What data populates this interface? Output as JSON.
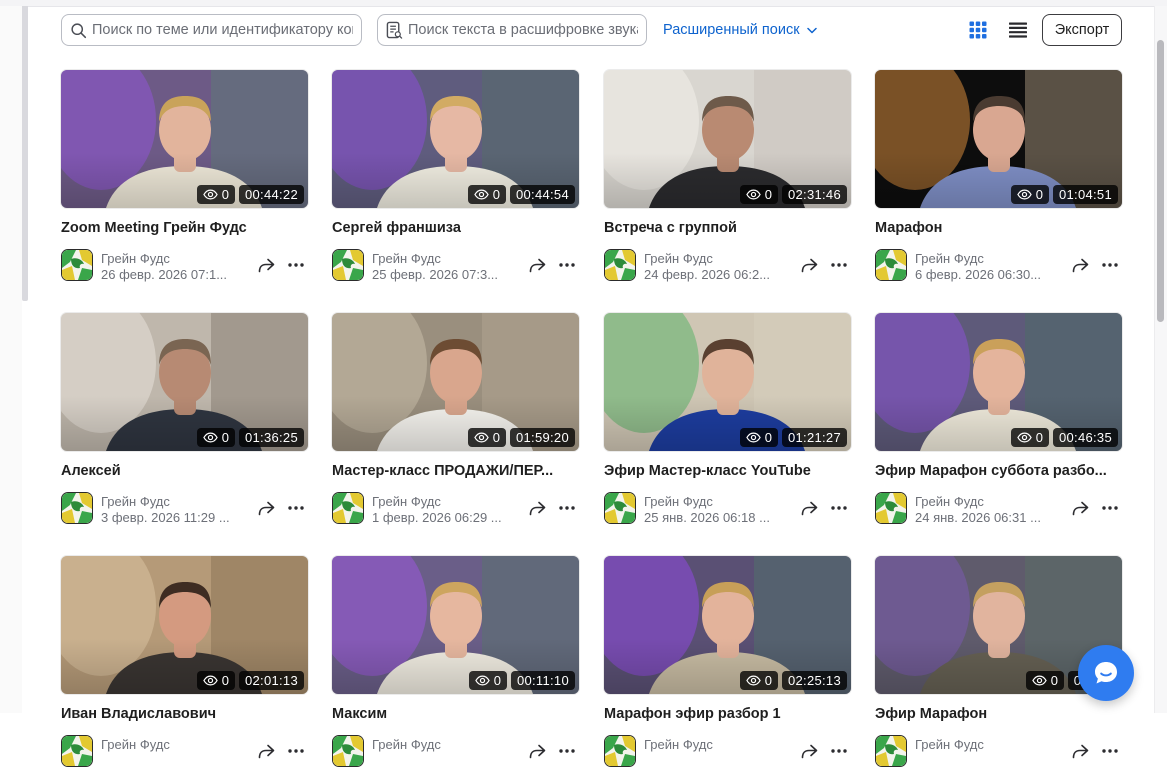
{
  "toolbar": {
    "topic_search_placeholder": "Поиск по теме или идентификатору конференции",
    "transcript_search_placeholder": "Поиск текста в расшифровке звука",
    "advanced_search_label": "Расширенный поиск",
    "export_label": "Экспорт",
    "view_mode": "grid"
  },
  "recordings": [
    {
      "title": "Zoom Meeting Грейн Фудс",
      "owner": "Грейн Фудс",
      "date": "26 февр. 2026 07:1...",
      "views": "0",
      "duration": "00:44:22"
    },
    {
      "title": "Сергей франшиза",
      "owner": "Грейн Фудс",
      "date": "25 февр. 2026 07:3...",
      "views": "0",
      "duration": "00:44:54"
    },
    {
      "title": "Встреча с группой",
      "owner": "Грейн Фудс",
      "date": "24 февр. 2026 06:2...",
      "views": "0",
      "duration": "02:31:46"
    },
    {
      "title": "Марафон",
      "owner": "Грейн Фудс",
      "date": "6 февр. 2026 06:30...",
      "views": "0",
      "duration": "01:04:51"
    },
    {
      "title": "Алексей",
      "owner": "Грейн Фудс",
      "date": "3 февр. 2026 11:29 ...",
      "views": "0",
      "duration": "01:36:25"
    },
    {
      "title": "Мастер-класс ПРОДАЖИ/ПЕР...",
      "owner": "Грейн Фудс",
      "date": "1 февр. 2026 06:29 ...",
      "views": "0",
      "duration": "01:59:20"
    },
    {
      "title": "Эфир Мастер-класс YouTube",
      "owner": "Грейн Фудс",
      "date": "25 янв. 2026 06:18 ...",
      "views": "0",
      "duration": "01:21:27"
    },
    {
      "title": "Эфир Марафон суббота разбо...",
      "owner": "Грейн Фудс",
      "date": "24 янв. 2026 06:31 ...",
      "views": "0",
      "duration": "00:46:35"
    },
    {
      "title": "Иван Владиславович",
      "owner": "Грейн Фудс",
      "date": "",
      "views": "0",
      "duration": "02:01:13"
    },
    {
      "title": "Максим",
      "owner": "Грейн Фудс",
      "date": "",
      "views": "0",
      "duration": "00:11:10"
    },
    {
      "title": "Марафон эфир разбор 1",
      "owner": "Грейн Фудс",
      "date": "",
      "views": "0",
      "duration": "02:25:13"
    },
    {
      "title": "Эфир Марафон",
      "owner": "Грейн Фудс",
      "date": "",
      "views": "0",
      "duration": "00:3..."
    }
  ],
  "thumb_palettes": [
    {
      "bg": "#6d5a86",
      "accent": "#8f56d6",
      "wall": "#5f7a78",
      "skin": "#e2b49c",
      "shirt": "#eee8d8",
      "hair": "#c9a35a"
    },
    {
      "bg": "#5f5c7e",
      "accent": "#8a4fd6",
      "wall": "#556d6a",
      "skin": "#e6b8a4",
      "shirt": "#f1eee2",
      "hair": "#d2ab64"
    },
    {
      "bg": "#d9d6d0",
      "accent": "#f2f0ea",
      "wall": "#c8c3bb",
      "skin": "#b98a72",
      "shirt": "#2b2b2e",
      "hair": "#6e5a4a"
    },
    {
      "bg": "#0d0d0d",
      "accent": "#d58a3c",
      "wall": "#9b8b74",
      "skin": "#d9a791",
      "shirt": "#7f8fc6",
      "hair": "#4a3b31"
    },
    {
      "bg": "#bfb7ac",
      "accent": "#e7e2da",
      "wall": "#8a8276",
      "skin": "#b78a73",
      "shirt": "#2f3540",
      "hair": "#7a6552"
    },
    {
      "bg": "#9a8f7e",
      "accent": "#c9bda8",
      "wall": "#b1a48f",
      "skin": "#d9a68d",
      "shirt": "#f5f3ee",
      "hair": "#6d4c33"
    },
    {
      "bg": "#cfc6b4",
      "accent": "#5db36a",
      "wall": "#d7cfbd",
      "skin": "#e0b39a",
      "shirt": "#1d3da0",
      "hair": "#5a4030"
    },
    {
      "bg": "#5e5a7a",
      "accent": "#8a52d4",
      "wall": "#4f6c68",
      "skin": "#e4b49c",
      "shirt": "#efeadb",
      "hair": "#caa05a"
    },
    {
      "bg": "#b59a78",
      "accent": "#d9c2a0",
      "wall": "#8d7758",
      "skin": "#d49a80",
      "shirt": "#3a3532",
      "hair": "#3e2c22"
    },
    {
      "bg": "#6a5e88",
      "accent": "#9a58dc",
      "wall": "#5a7370",
      "skin": "#e6b79f",
      "shirt": "#f0ece1",
      "hair": "#cda55f"
    },
    {
      "bg": "#5a5074",
      "accent": "#9048e0",
      "wall": "#52706c",
      "skin": "#e3b39b",
      "shirt": "#c8bca3",
      "hair": "#c79f58"
    },
    {
      "bg": "#5f5b6c",
      "accent": "#7a5ab0",
      "wall": "#5a6e66",
      "skin": "#e1b49e",
      "shirt": "#656053",
      "hair": "#c4a060"
    }
  ]
}
